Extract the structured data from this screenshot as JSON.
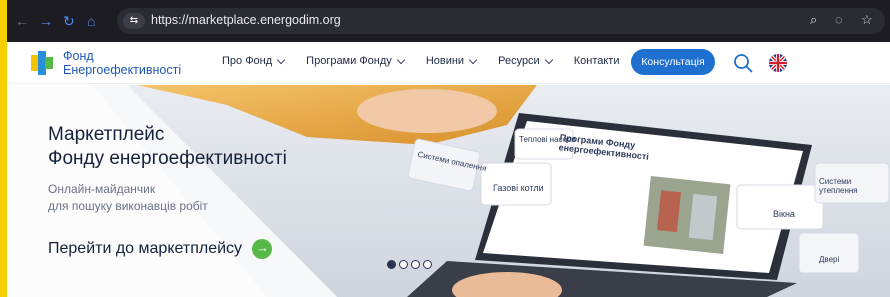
{
  "browser": {
    "url": "https://marketplace.energodim.org",
    "site_icon": "⇆"
  },
  "header": {
    "logo_line1": "Фонд",
    "logo_line2": "Енергоефективності",
    "menu": [
      {
        "label": "Про Фонд"
      },
      {
        "label": "Програми Фонду"
      },
      {
        "label": "Новини"
      },
      {
        "label": "Ресурси"
      },
      {
        "label": "Контакти"
      }
    ],
    "cta_label": "Консультація"
  },
  "hero": {
    "title_line1": "Маркетплейс",
    "title_line2": "Фонду енергоефективності",
    "subtitle_line1": "Онлайн-майданчик",
    "subtitle_line2": "для пошуку виконавців робіт",
    "link_label": "Перейти до маркетплейсу",
    "image_labels": {
      "screen_title": "Програми Фонду енергоефективності",
      "card_gas": "Газові котли",
      "card_windows": "Вікна",
      "card_systems": "Системи утеплення",
      "card_doors": "Двері",
      "card_heating": "Системи опалення",
      "card_heatpump": "Теплові насоси"
    }
  },
  "slider": {
    "active_index": 0,
    "count": 4
  },
  "colors": {
    "accent": "#1f6fd1",
    "brand_green": "#56b947",
    "logo_blue": "#1f58b5",
    "highlight": "#f5d000"
  }
}
